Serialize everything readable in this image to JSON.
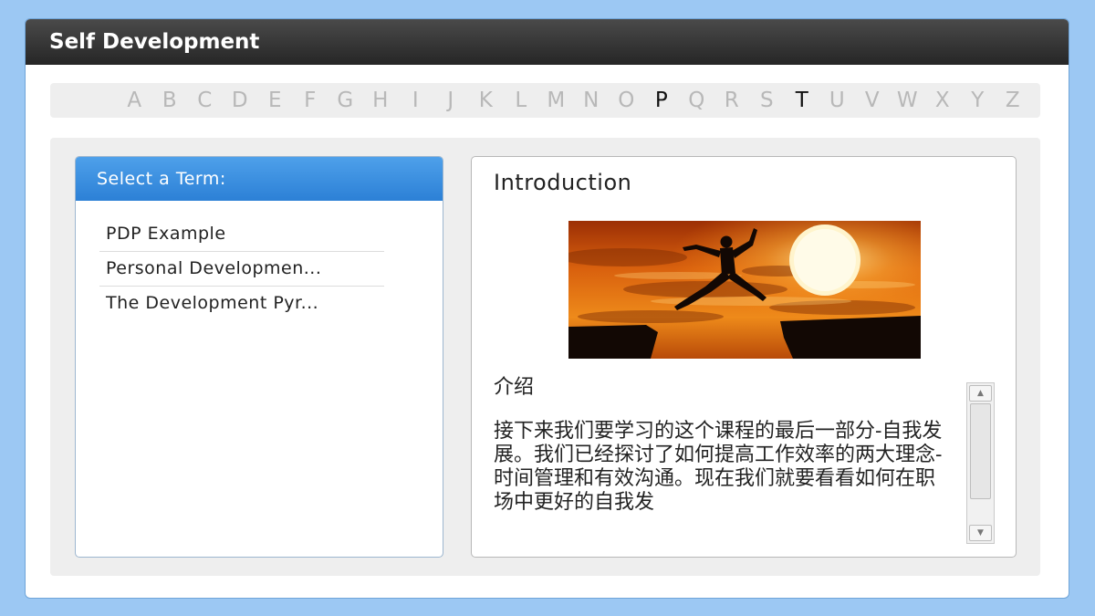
{
  "window": {
    "title": "Self Development"
  },
  "alphabet": {
    "letters": [
      "A",
      "B",
      "C",
      "D",
      "E",
      "F",
      "G",
      "H",
      "I",
      "J",
      "K",
      "L",
      "M",
      "N",
      "O",
      "P",
      "Q",
      "R",
      "S",
      "T",
      "U",
      "V",
      "W",
      "X",
      "Y",
      "Z",
      "#"
    ],
    "active": [
      "P",
      "T"
    ]
  },
  "terms": {
    "header": "Select a Term:",
    "items": [
      {
        "label": "PDP Example"
      },
      {
        "label": "Personal Developmen..."
      },
      {
        "label": "The Development Pyr..."
      }
    ]
  },
  "detail": {
    "title": "Introduction",
    "image_icon": "sunset-jump-image",
    "heading": "介绍",
    "body": "接下来我们要学习的这个课程的最后一部分-自我发展。我们已经探讨了如何提高工作效率的两大理念-时间管理和有效沟通。现在我们就要看看如何在职场中更好的自我发"
  },
  "colors": {
    "page_bg": "#9cc8f3",
    "titlebar": "#333333",
    "term_header": "#3a8ee2",
    "letter_inactive": "#b8b8b8",
    "letter_active": "#111111"
  }
}
